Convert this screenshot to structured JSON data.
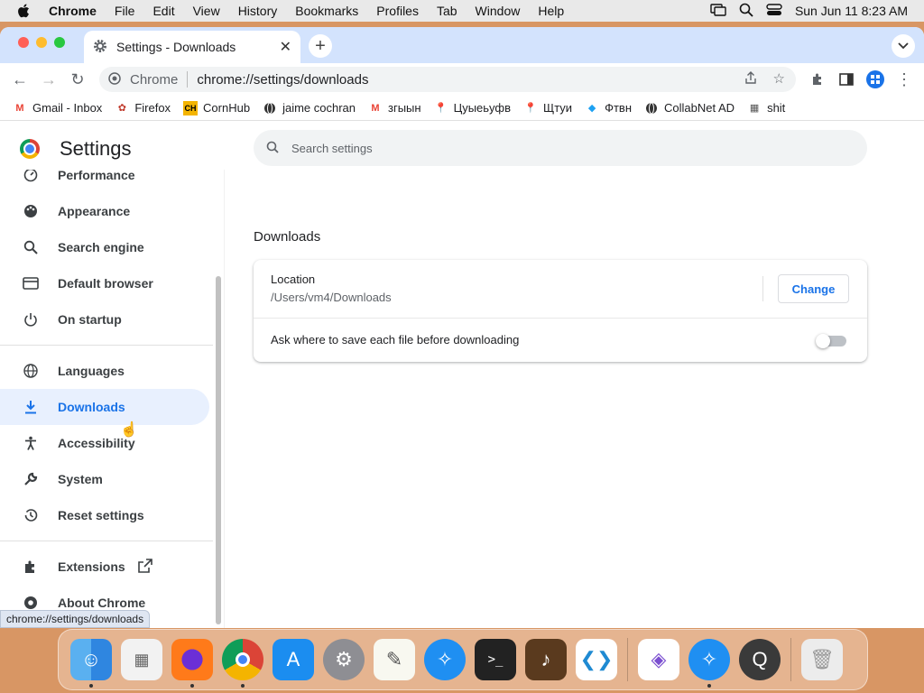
{
  "menubar": {
    "apple_icon": "apple-icon",
    "app_name": "Chrome",
    "items": [
      "File",
      "Edit",
      "View",
      "History",
      "Bookmarks",
      "Profiles",
      "Tab",
      "Window",
      "Help"
    ],
    "datetime": "Sun Jun 11  8:23 AM"
  },
  "tab": {
    "title": "Settings - Downloads",
    "icon": "gear-icon"
  },
  "omnibox": {
    "scheme_label": "Chrome",
    "url": "chrome://settings/downloads"
  },
  "bookmarks": [
    {
      "label": "Gmail - Inbox",
      "icon": "gmail-icon",
      "color": "#ea4335"
    },
    {
      "label": "Firefox",
      "icon": "firefox-icon",
      "color": "#c0392b"
    },
    {
      "label": "CornHub",
      "icon": "ch-icon",
      "color": "#f4b400"
    },
    {
      "label": "jaime cochran",
      "icon": "globe-icon",
      "color": "#333333"
    },
    {
      "label": "згыын",
      "icon": "gmail-icon",
      "color": "#ea4335"
    },
    {
      "label": "Цуыеьуфв",
      "icon": "maps-pin-icon",
      "color": "#34a853"
    },
    {
      "label": "Щтуи",
      "icon": "maps-pin-icon",
      "color": "#34a853"
    },
    {
      "label": "Фтвн",
      "icon": "diamond-icon",
      "color": "#1da1f2"
    },
    {
      "label": "CollabNet AD",
      "icon": "globe-icon",
      "color": "#333333"
    },
    {
      "label": "shit",
      "icon": "box-icon",
      "color": "#555555"
    }
  ],
  "settings": {
    "title": "Settings",
    "search_placeholder": "Search settings",
    "nav": [
      {
        "label": "Performance",
        "icon": "performance-icon"
      },
      {
        "label": "Appearance",
        "icon": "palette-icon"
      },
      {
        "label": "Search engine",
        "icon": "search-icon"
      },
      {
        "label": "Default browser",
        "icon": "browser-icon"
      },
      {
        "label": "On startup",
        "icon": "power-icon"
      },
      {
        "label": "Languages",
        "icon": "globe-icon"
      },
      {
        "label": "Downloads",
        "icon": "download-icon",
        "active": true
      },
      {
        "label": "Accessibility",
        "icon": "accessibility-icon"
      },
      {
        "label": "System",
        "icon": "wrench-icon"
      },
      {
        "label": "Reset settings",
        "icon": "history-icon"
      },
      {
        "label": "Extensions",
        "icon": "puzzle-icon"
      },
      {
        "label": "About Chrome",
        "icon": "chrome-icon"
      }
    ]
  },
  "downloads": {
    "heading": "Downloads",
    "location_label": "Location",
    "location_path": "/Users/vm4/Downloads",
    "change_label": "Change",
    "ask_label": "Ask where to save each file before downloading",
    "ask_enabled": false
  },
  "status_url": "chrome://settings/downloads",
  "dock": [
    "finder-icon",
    "launchpad-icon",
    "firefox-icon",
    "chrome-icon",
    "app-store-icon",
    "system-preferences-icon",
    "textedit-icon",
    "safari-icon",
    "terminal-icon",
    "garageband-icon",
    "vscode-icon",
    "visual-studio-icon",
    "safari-icon",
    "quicktime-icon",
    "trash-icon"
  ],
  "colors": {
    "accent": "#1a73e8",
    "active_bg": "#e8f0fe",
    "tabstrip": "#d3e3fd"
  }
}
